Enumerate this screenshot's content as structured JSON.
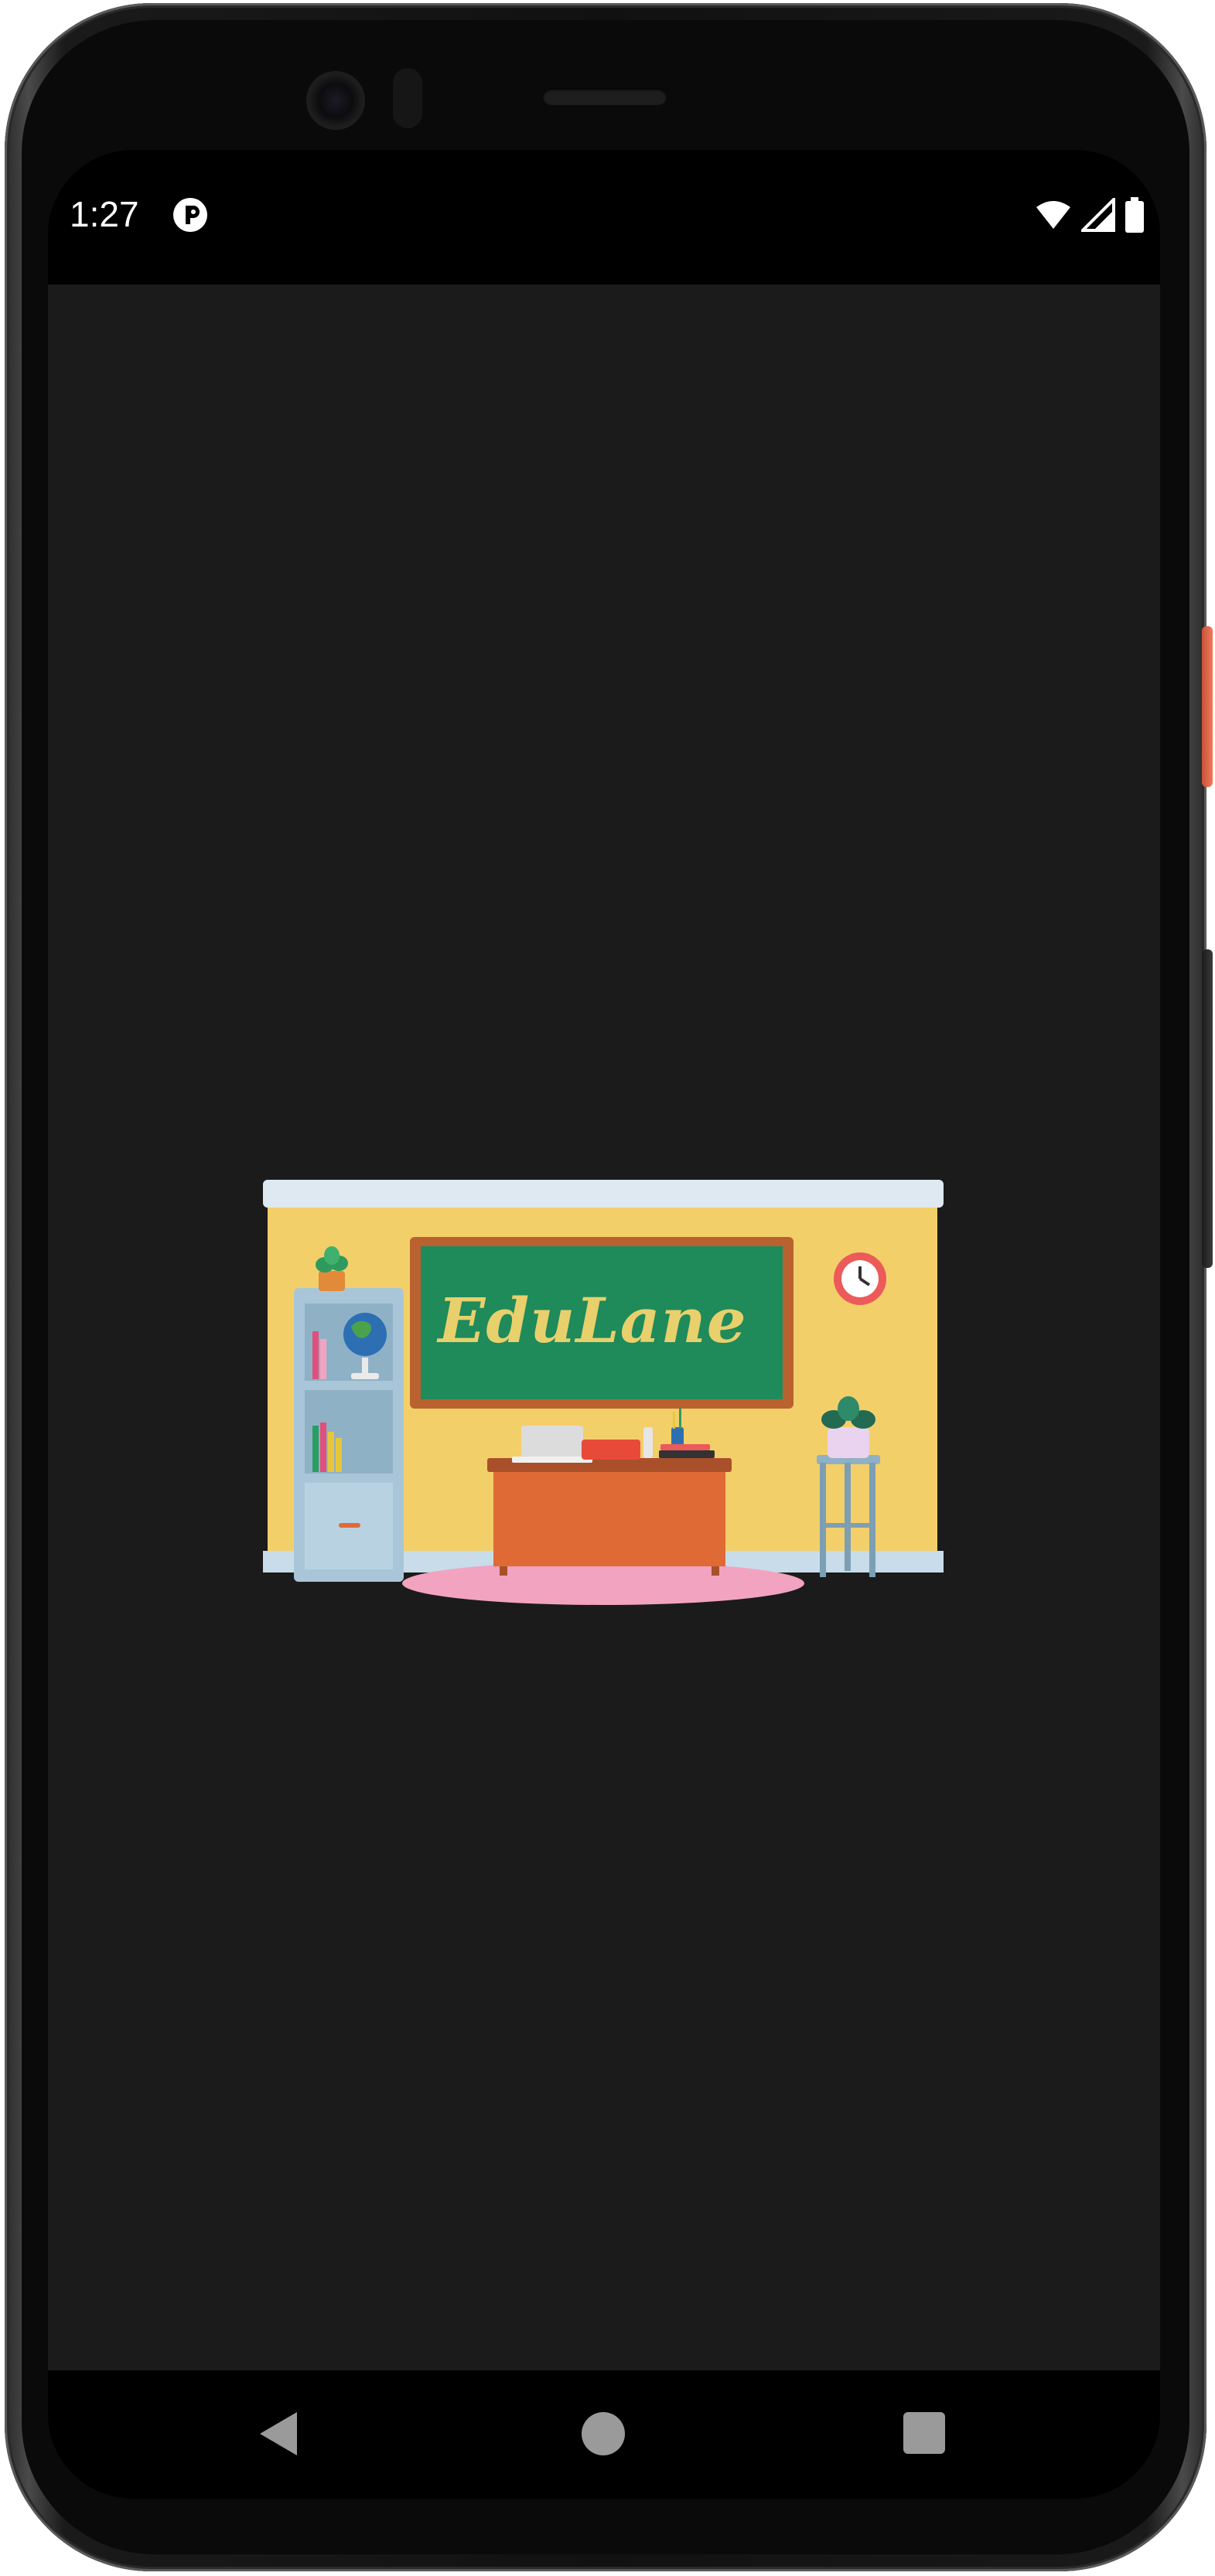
{
  "status_bar": {
    "time": "1:27",
    "app_icon": "pocketcasts-like-circle-icon",
    "wifi_icon": "wifi-icon",
    "signal_icon": "cell-signal-icon",
    "battery_icon": "battery-icon"
  },
  "splash": {
    "title": "EduLane"
  },
  "nav_bar": {
    "back_icon": "back-triangle-icon",
    "home_icon": "home-circle-icon",
    "recents_icon": "recents-square-icon"
  },
  "colors": {
    "screen_background": "#1b1b1b",
    "wall": "#f3cf6a",
    "chalkboard": "#1f8a5a",
    "board_frame": "#b9622f",
    "title": "#e8d06c",
    "desk": "#e06a35",
    "rug": "#f2a3c0",
    "shelf": "#a9c6d8"
  }
}
